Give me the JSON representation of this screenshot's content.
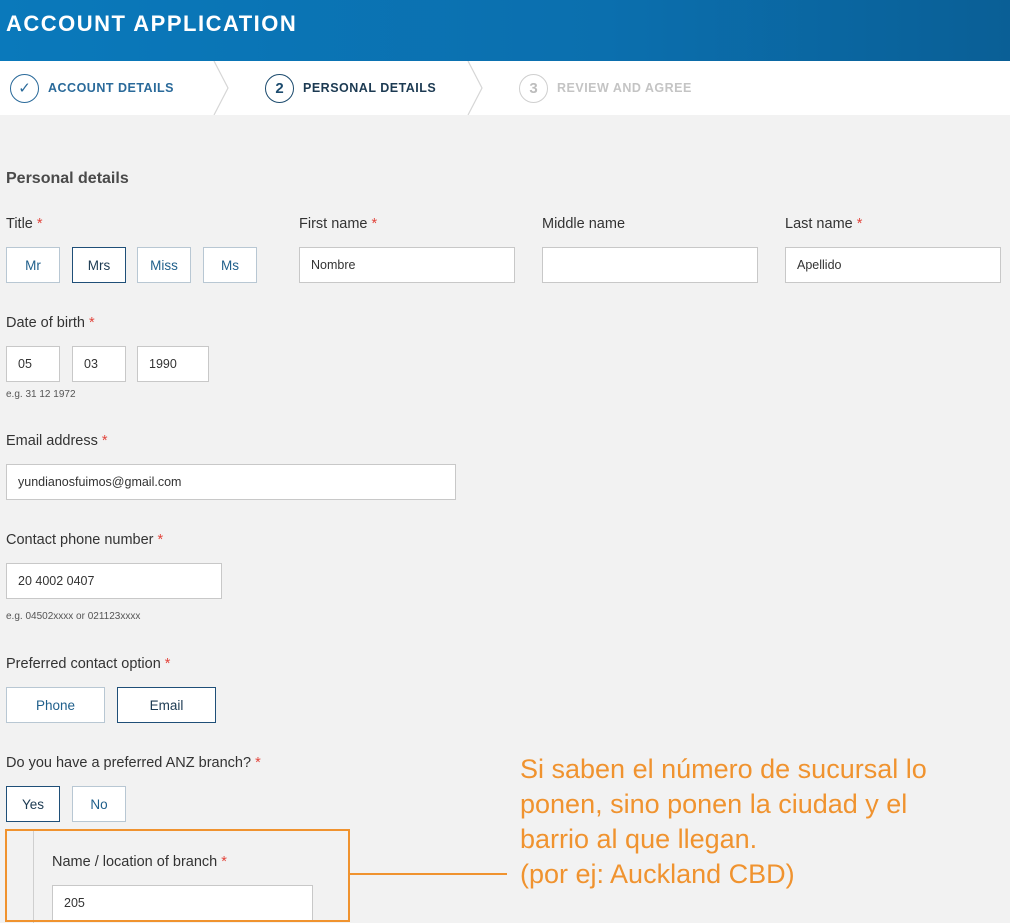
{
  "header": {
    "title": "ACCOUNT APPLICATION"
  },
  "steps": [
    {
      "number": "✓",
      "label": "ACCOUNT DETAILS",
      "state": "completed"
    },
    {
      "number": "2",
      "label": "PERSONAL DETAILS",
      "state": "current"
    },
    {
      "number": "3",
      "label": "REVIEW AND AGREE",
      "state": "upcoming"
    }
  ],
  "form": {
    "section_title": "Personal details",
    "required_mark": "*",
    "title": {
      "label": "Title",
      "options": [
        "Mr",
        "Mrs",
        "Miss",
        "Ms"
      ],
      "selected": "Mrs"
    },
    "first_name": {
      "label": "First name",
      "value": "Nombre"
    },
    "middle_name": {
      "label": "Middle name",
      "value": ""
    },
    "last_name": {
      "label": "Last name",
      "value": "Apellido"
    },
    "dob": {
      "label": "Date of birth",
      "day": "05",
      "month": "03",
      "year": "1990",
      "hint": "e.g. 31 12 1972"
    },
    "email": {
      "label": "Email address",
      "value": "yundianosfuimos@gmail.com"
    },
    "phone": {
      "label": "Contact phone number",
      "value": "20 4002 0407",
      "hint": "e.g. 04502xxxx or 021123xxxx"
    },
    "contact_option": {
      "label": "Preferred contact option",
      "options": [
        "Phone",
        "Email"
      ],
      "selected": "Email"
    },
    "branch_pref": {
      "label": "Do you have a preferred ANZ branch?",
      "options": [
        "Yes",
        "No"
      ],
      "selected": "Yes"
    },
    "branch_name": {
      "label": "Name / location of branch",
      "value": "205"
    }
  },
  "annotation": {
    "lines": [
      "Si saben el número de sucursal lo",
      "ponen, sino ponen la ciudad y el",
      "barrio al que llegan.",
      "(por ej: Auckland CBD)"
    ],
    "color": "#f0932f"
  },
  "colors": {
    "header": "#0a79bb",
    "required": "#e2443b",
    "accent": "#1f5f8b"
  }
}
